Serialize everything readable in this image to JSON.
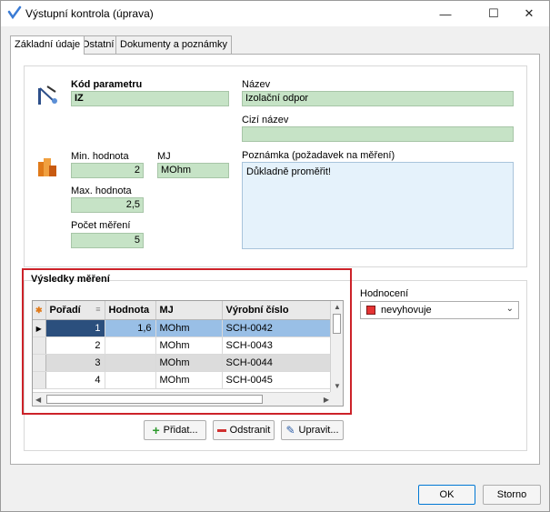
{
  "window": {
    "title": "Výstupní kontrola (úprava)",
    "min_glyph": "—",
    "max_glyph": "☐",
    "close_glyph": "✕"
  },
  "tabs": [
    {
      "label": "Základní údaje"
    },
    {
      "label": "Ostatní"
    },
    {
      "label": "Dokumenty a poznámky"
    }
  ],
  "form": {
    "kod_parametru_label": "Kód parametru",
    "kod_parametru_value": "IZ",
    "nazev_label": "Název",
    "nazev_value": "Izolační odpor",
    "cizi_nazev_label": "Cizí název",
    "cizi_nazev_value": "",
    "min_label": "Min. hodnota",
    "min_value": "2",
    "mj_label": "MJ",
    "mj_value": "MOhm",
    "max_label": "Max. hodnota",
    "max_value": "2,5",
    "pocet_label": "Počet měření",
    "pocet_value": "5",
    "poznamka_label": "Poznámka (požadavek na měření)",
    "poznamka_value": "Důkladně proměřit!"
  },
  "results": {
    "title": "Výsledky měření",
    "columns": [
      "Pořadí",
      "Hodnota",
      "MJ",
      "Výrobní číslo"
    ],
    "rows": [
      {
        "poradi": "1",
        "hodnota": "1,6",
        "mj": "MOhm",
        "vc": "SCH-0042"
      },
      {
        "poradi": "2",
        "hodnota": "",
        "mj": "MOhm",
        "vc": "SCH-0043"
      },
      {
        "poradi": "3",
        "hodnota": "",
        "mj": "MOhm",
        "vc": "SCH-0044"
      },
      {
        "poradi": "4",
        "hodnota": "",
        "mj": "MOhm",
        "vc": "SCH-0045"
      }
    ]
  },
  "hodnoceni": {
    "label": "Hodnocení",
    "value": "nevyhovuje",
    "color": "#e53333"
  },
  "actions": {
    "add": "Přidat...",
    "remove": "Odstranit",
    "edit": "Upravit..."
  },
  "footer": {
    "ok": "OK",
    "cancel": "Storno"
  },
  "colors": {
    "field_bg": "#c6e3c6",
    "memo_bg": "#e5f2fb",
    "highlight": "#cc2229",
    "selected_row": "#99bfe6"
  }
}
